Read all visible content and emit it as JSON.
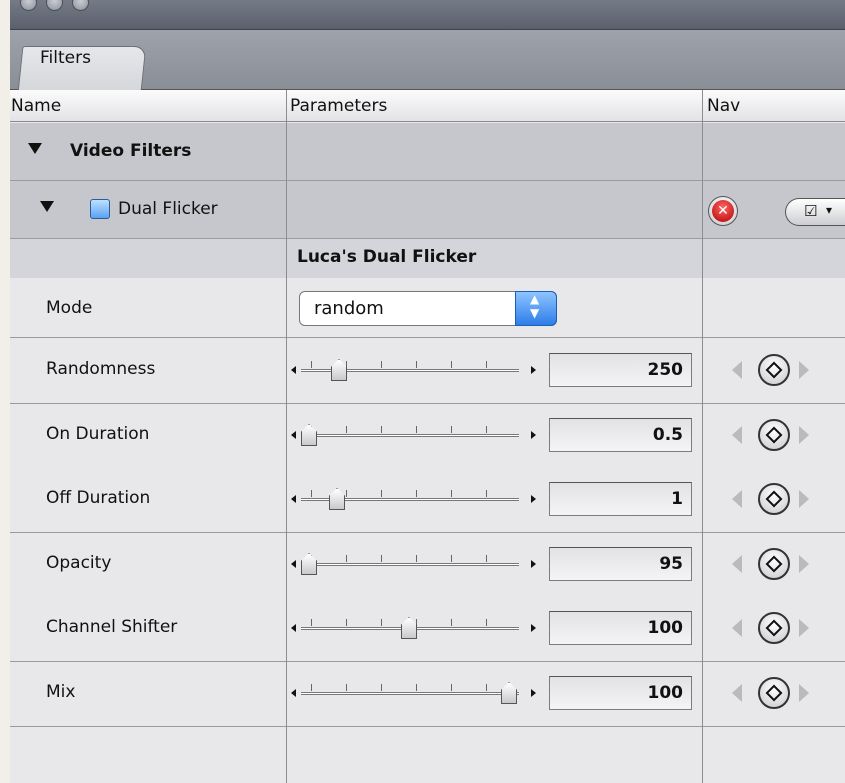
{
  "tab": {
    "label": "Filters"
  },
  "columns": {
    "name": "Name",
    "parameters": "Parameters",
    "nav": "Nav"
  },
  "groups": {
    "video_filters": "Video Filters",
    "filter_name": "Dual Flicker",
    "filter_title": "Luca's Dual Flicker"
  },
  "mode": {
    "label": "Mode",
    "value": "random"
  },
  "params": [
    {
      "label": "Randomness",
      "value": "250",
      "position": 0.15
    },
    {
      "label": "On Duration",
      "value": "0.5",
      "position": 0.0
    },
    {
      "label": "Off Duration",
      "value": "1",
      "position": 0.14
    },
    {
      "label": "Opacity",
      "value": "95",
      "position": 0.0
    },
    {
      "label": "Channel Shifter",
      "value": "100",
      "position": 0.5
    },
    {
      "label": "Mix",
      "value": "100",
      "position": 1.0
    }
  ],
  "icons": {
    "disclosure": "triangle-down-icon",
    "checkbox": "checkbox-checked-icon",
    "remove": "close-icon",
    "menu": "checkbox-menu-icon",
    "keyframe": "keyframe-icon"
  }
}
